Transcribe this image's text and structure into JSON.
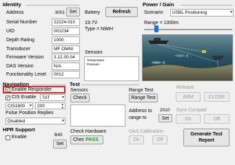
{
  "identity": {
    "title": "Identity",
    "address_label": "Address",
    "address_value": "3001",
    "set_label": "Set",
    "serial_label": "Serial Number",
    "serial_value": "22224-010",
    "uid_label": "UID",
    "uid_value": "001234",
    "depth_label": "Depth Rating",
    "depth_value": "1000",
    "transducer_label": "Transducer",
    "transducer_value": "MF OMNI",
    "firmware_label": "Firmware Version",
    "firmware_value": "3.12.00.04",
    "das_label": "DAS Version",
    "das_value": "N/A",
    "functionality_label": "Functionality Level",
    "functionality_value": "0012"
  },
  "battery": {
    "label": "Battery",
    "voltage": "19.7V",
    "type": "Type = NIMH",
    "refresh_label": "Refresh"
  },
  "sensors_box": {
    "label": "Sensors",
    "line1": "Temperature",
    "line2": "Pressure"
  },
  "power_gain": {
    "title": "Power / Gain",
    "scenario_label": "Scenario",
    "scenario_value": "USBL Positioning",
    "range_label": "Range = 1000m",
    "slider_fraction": 0.12
  },
  "navigation": {
    "title": "Navigation",
    "enable_responder_label": "Enable Responder",
    "cis_enable_label": "CIS Enable",
    "cis_enable_value": "TAT",
    "cis_select_value": "CIS1600",
    "spin_value": "200",
    "pulse_label": "Pulse Position Replies",
    "pulse_value": "Disabled"
  },
  "hpr": {
    "title": "HPR Support",
    "enable_label": "Enable",
    "field_value": "B45",
    "set_label": "Set"
  },
  "test": {
    "title": "Test",
    "sensors_label": "Sensors",
    "check_label": "Check",
    "range_test_title": "Range Test",
    "range_test_button": "Range Test",
    "address_label": "Address to",
    "range_to_label": "range to",
    "address_value": "2010",
    "set_label": "Set",
    "check_hw_label": "Check Hardware",
    "check_hw_button": "Chec",
    "pass_label": "PASS",
    "das_cal_label": "DAS Calibration",
    "on_label": "On",
    "off_label": "Off",
    "generate_label": "Generate Test Report"
  },
  "release": {
    "title": "Release",
    "arm_label": "ARM",
    "close_label": "CLOSE"
  },
  "gyro": {
    "title": "Gyro Compatt",
    "on_label": "On",
    "off_label": "Off"
  },
  "colors": {
    "highlight": "#e02020",
    "pass": "#1a9a1a",
    "scene_water": "#1c4a5c"
  }
}
